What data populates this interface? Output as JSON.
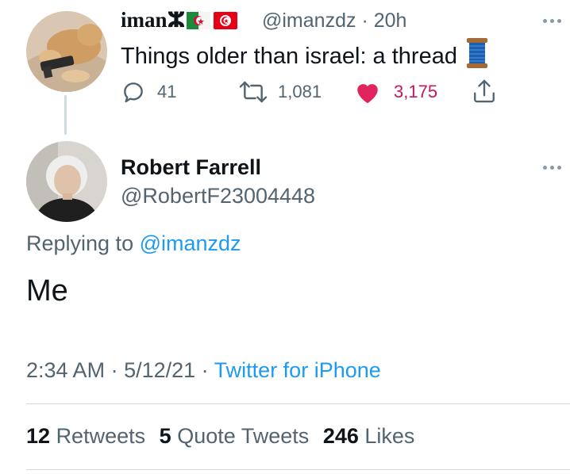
{
  "tweet1": {
    "name": "iman",
    "handle": "@imanzdz",
    "time": "· 20h",
    "text": "Things older than israel: a thread",
    "replies": "41",
    "retweets": "1,081",
    "likes": "3,175",
    "liked": true,
    "colors": {
      "like": "#e0245e",
      "likes_text": "#c0195d"
    },
    "icons": [
      "amazigh-symbol-icon",
      "algeria-flag-icon",
      "tunisia-flag-icon",
      "spool-of-thread-icon"
    ]
  },
  "tweet2": {
    "name": "Robert Farrell",
    "handle": "@RobertF23004448",
    "replying_prefix": "Replying to",
    "replying_handle": "@imanzdz",
    "text": "Me",
    "time": "2:34 AM",
    "date": "5/12/21",
    "source": "Twitter for iPhone",
    "retweets_count": "12",
    "retweets_label": "Retweets",
    "quotes_count": "5",
    "quotes_label": "Quote Tweets",
    "likes_count": "246",
    "likes_label": "Likes"
  },
  "colors": {
    "link": "#1d9bf0",
    "muted": "#536471",
    "text": "#0f1419",
    "divider": "#cfd9de"
  }
}
